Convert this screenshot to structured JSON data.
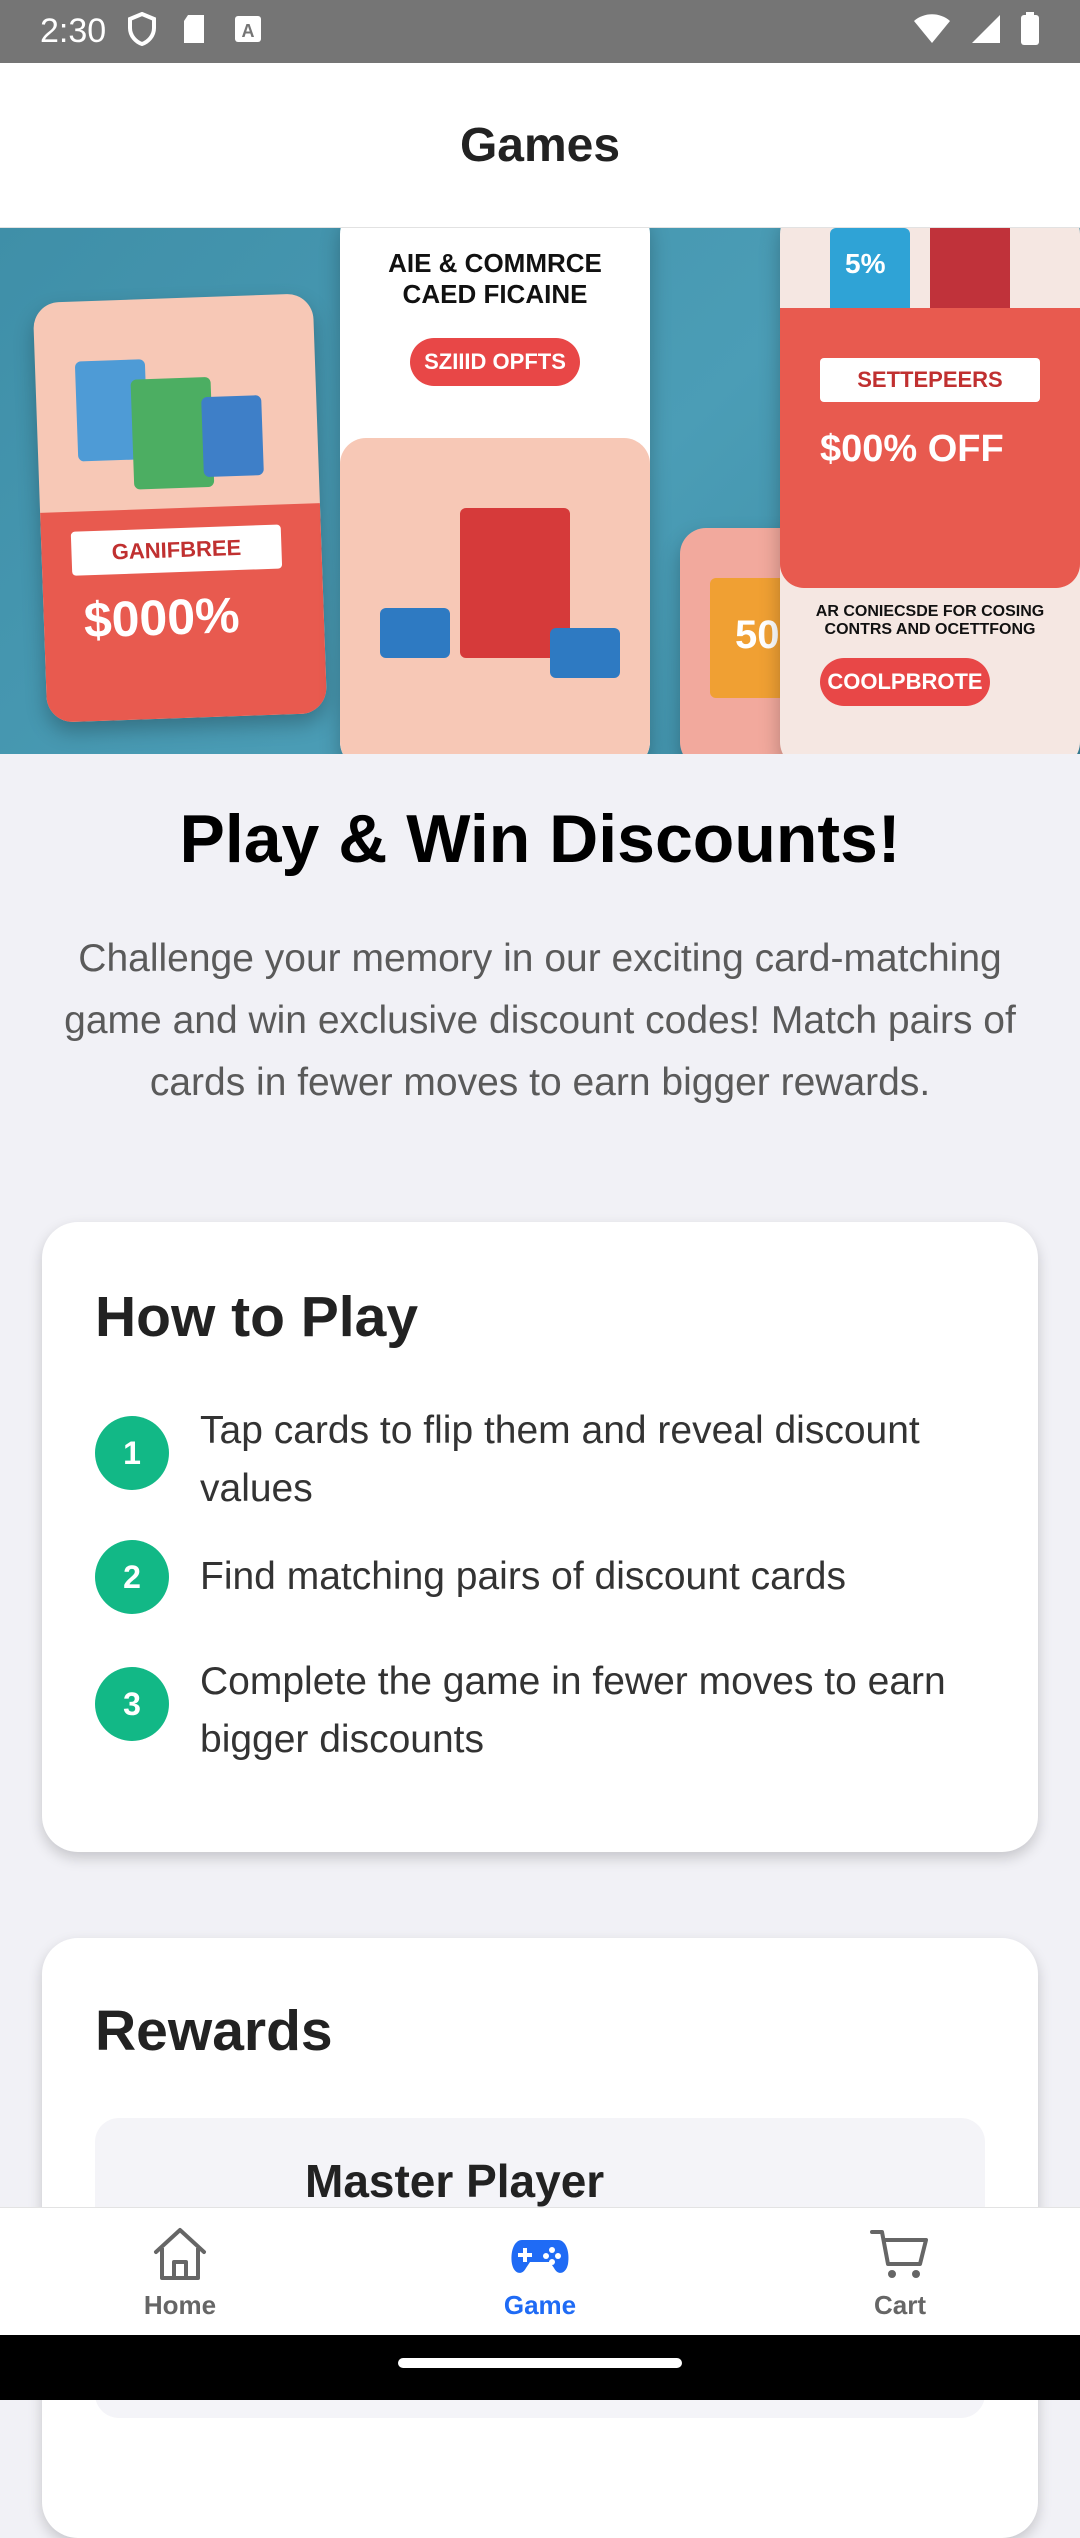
{
  "status_bar": {
    "time": "2:30",
    "icons_left": [
      "shield-icon",
      "sd-card-icon",
      "a-icon"
    ],
    "icons_right": [
      "wifi-icon",
      "signal-icon",
      "battery-icon"
    ]
  },
  "app_bar": {
    "title": "Games"
  },
  "banner": {
    "card_a_label": "GANIFBREE",
    "card_a_value": "$000%",
    "card_b_title": "AIE & COMMRCE CAED FICAINE",
    "card_b_pill": "SZIIID OPFTS",
    "card_c_value": "50",
    "card_d_top": "5%",
    "card_d_label": "SETTEPEERS",
    "card_d_value": "$00% OFF",
    "card_d_dark": "AR CONIECSDE FOR COSING CONTRS AND OCETTFONG",
    "card_d_pill": "COOLPBROTE"
  },
  "hero": {
    "headline": "Play & Win Discounts!",
    "intro": "Challenge your memory in our exciting card-matching game and win exclusive discount codes! Match pairs of cards in fewer moves to earn bigger rewards."
  },
  "how_to_play": {
    "title": "How to Play",
    "steps": [
      {
        "num": "1",
        "text": "Tap cards to flip them and reveal discount values"
      },
      {
        "num": "2",
        "text": "Find matching pairs of discount cards"
      },
      {
        "num": "3",
        "text": "Complete the game in fewer moves to earn bigger discounts"
      }
    ]
  },
  "rewards": {
    "title": "Rewards",
    "items": [
      {
        "title": "Master Player"
      }
    ]
  },
  "bottom_nav": {
    "items": [
      {
        "label": "Home",
        "icon": "home-icon"
      },
      {
        "label": "Game",
        "icon": "gamepad-icon"
      },
      {
        "label": "Cart",
        "icon": "cart-icon"
      }
    ],
    "active": "Game",
    "active_color": "#1f6bf5"
  },
  "colors": {
    "step_badge": "#12b886",
    "status_bar": "#757575"
  }
}
